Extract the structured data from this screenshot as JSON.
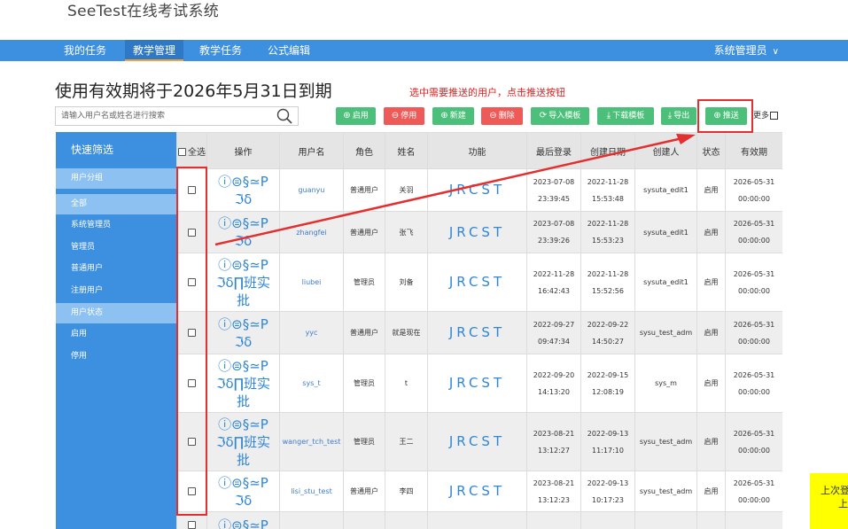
{
  "app": {
    "title": "SeeTest在线考试系统"
  },
  "nav": {
    "items": [
      {
        "label": "我的任务",
        "active": false
      },
      {
        "label": "教学管理",
        "active": true
      },
      {
        "label": "教学任务",
        "active": false
      },
      {
        "label": "公式编辑",
        "active": false
      }
    ],
    "user": "系统管理员"
  },
  "page": {
    "title": "使用有效期将于2026年5月31日到期",
    "hint": "选中需要推送的用户，点击推送按钮"
  },
  "search": {
    "placeholder": "请输入用户名或姓名进行搜索",
    "icon": "search-icon"
  },
  "toolbar": {
    "enable": "启用",
    "disable": "停用",
    "new": "新建",
    "delete": "删除",
    "import_template": "导入模板",
    "download_template": "下载模板",
    "export": "导出",
    "push": "推送",
    "more": "更多"
  },
  "sidebar": {
    "header": "快速筛选",
    "group_user": "用户分组",
    "items_user": [
      "全部",
      "系统管理员",
      "管理员",
      "普通用户",
      "注册用户"
    ],
    "group_status": "用户状态",
    "items_status": [
      "启用",
      "停用"
    ]
  },
  "table": {
    "headers": {
      "select_all": "全选",
      "ops": "操作",
      "username": "用户名",
      "role": "角色",
      "name": "姓名",
      "func": "功能",
      "last_login": "最后登录",
      "created": "创建日期",
      "creator": "创建人",
      "status": "状态",
      "expiry": "有效期"
    },
    "rows": [
      {
        "ops": "ⓘ⊜§≃P\nℑδ",
        "username": "guanyu",
        "role": "普通用户",
        "name": "关羽",
        "func": "JRCST",
        "login_date": "2023-07-08",
        "login_time": "23:39:45",
        "created_date": "2022-11-28",
        "created_time": "15:53:48",
        "creator": "sysuta_edit1",
        "status": "启用",
        "exp_date": "2026-05-31",
        "exp_time": "00:00:00"
      },
      {
        "ops": "ⓘ⊜§≃P\nℑδ",
        "username": "zhangfei",
        "role": "普通用户",
        "name": "张飞",
        "func": "JRCST",
        "login_date": "2023-07-08",
        "login_time": "23:39:26",
        "created_date": "2022-11-28",
        "created_time": "15:53:23",
        "creator": "sysuta_edit1",
        "status": "启用",
        "exp_date": "2026-05-31",
        "exp_time": "00:00:00"
      },
      {
        "ops": "ⓘ⊜§≃P\nℑδ∏班实\n批",
        "username": "liubei",
        "role": "管理员",
        "name": "刘备",
        "func": "JRCST",
        "login_date": "2022-11-28",
        "login_time": "16:42:43",
        "created_date": "2022-11-28",
        "created_time": "15:52:56",
        "creator": "sysuta_edit1",
        "status": "启用",
        "exp_date": "2026-05-31",
        "exp_time": "00:00:00"
      },
      {
        "ops": "ⓘ⊜§≃P\nℑδ",
        "username": "yyc",
        "role": "普通用户",
        "name": "就是现在",
        "func": "JRCST",
        "login_date": "2022-09-27",
        "login_time": "09:47:34",
        "created_date": "2022-09-22",
        "created_time": "14:50:27",
        "creator": "sysu_test_adm",
        "status": "启用",
        "exp_date": "2026-05-31",
        "exp_time": "00:00:00"
      },
      {
        "ops": "ⓘ⊜§≃P\nℑδ∏班实\n批",
        "username": "sys_t",
        "role": "管理员",
        "name": "t",
        "func": "JRCST",
        "login_date": "2022-09-20",
        "login_time": "14:13:20",
        "created_date": "2022-09-15",
        "created_time": "12:08:19",
        "creator": "sys_m",
        "status": "启用",
        "exp_date": "2026-05-31",
        "exp_time": "00:00:00"
      },
      {
        "ops": "ⓘ⊜§≃P\nℑδ∏班实\n批",
        "username": "wanger_tch_test",
        "role": "管理员",
        "name": "王二",
        "func": "JRCST",
        "login_date": "2023-08-21",
        "login_time": "13:12:27",
        "created_date": "2022-09-13",
        "created_time": "11:17:10",
        "creator": "sysu_test_adm",
        "status": "启用",
        "exp_date": "2026-05-31",
        "exp_time": "00:00:00"
      },
      {
        "ops": "ⓘ⊜§≃P\nℑδ",
        "username": "lisi_stu_test",
        "role": "普通用户",
        "name": "李四",
        "func": "JRCST",
        "login_date": "2023-08-21",
        "login_time": "13:12:23",
        "created_date": "2022-09-13",
        "created_time": "10:17:23",
        "creator": "sysu_test_adm",
        "status": "启用",
        "exp_date": "2026-05-31",
        "exp_time": "00:00:00"
      },
      {
        "ops": "ⓘ⊜§≃P",
        "username": "",
        "role": "",
        "name": "",
        "func": "",
        "login_date": "",
        "login_time": "",
        "created_date": "",
        "created_time": "",
        "creator": "",
        "status": "",
        "exp_date": "",
        "exp_time": ""
      }
    ]
  },
  "notice": {
    "line1": "上次登",
    "line2": "上"
  },
  "colors": {
    "nav": "#3d8fe0",
    "green": "#4cc07a",
    "red": "#ee5a57",
    "annotation": "#e32f2f",
    "notice": "#ffff00"
  }
}
